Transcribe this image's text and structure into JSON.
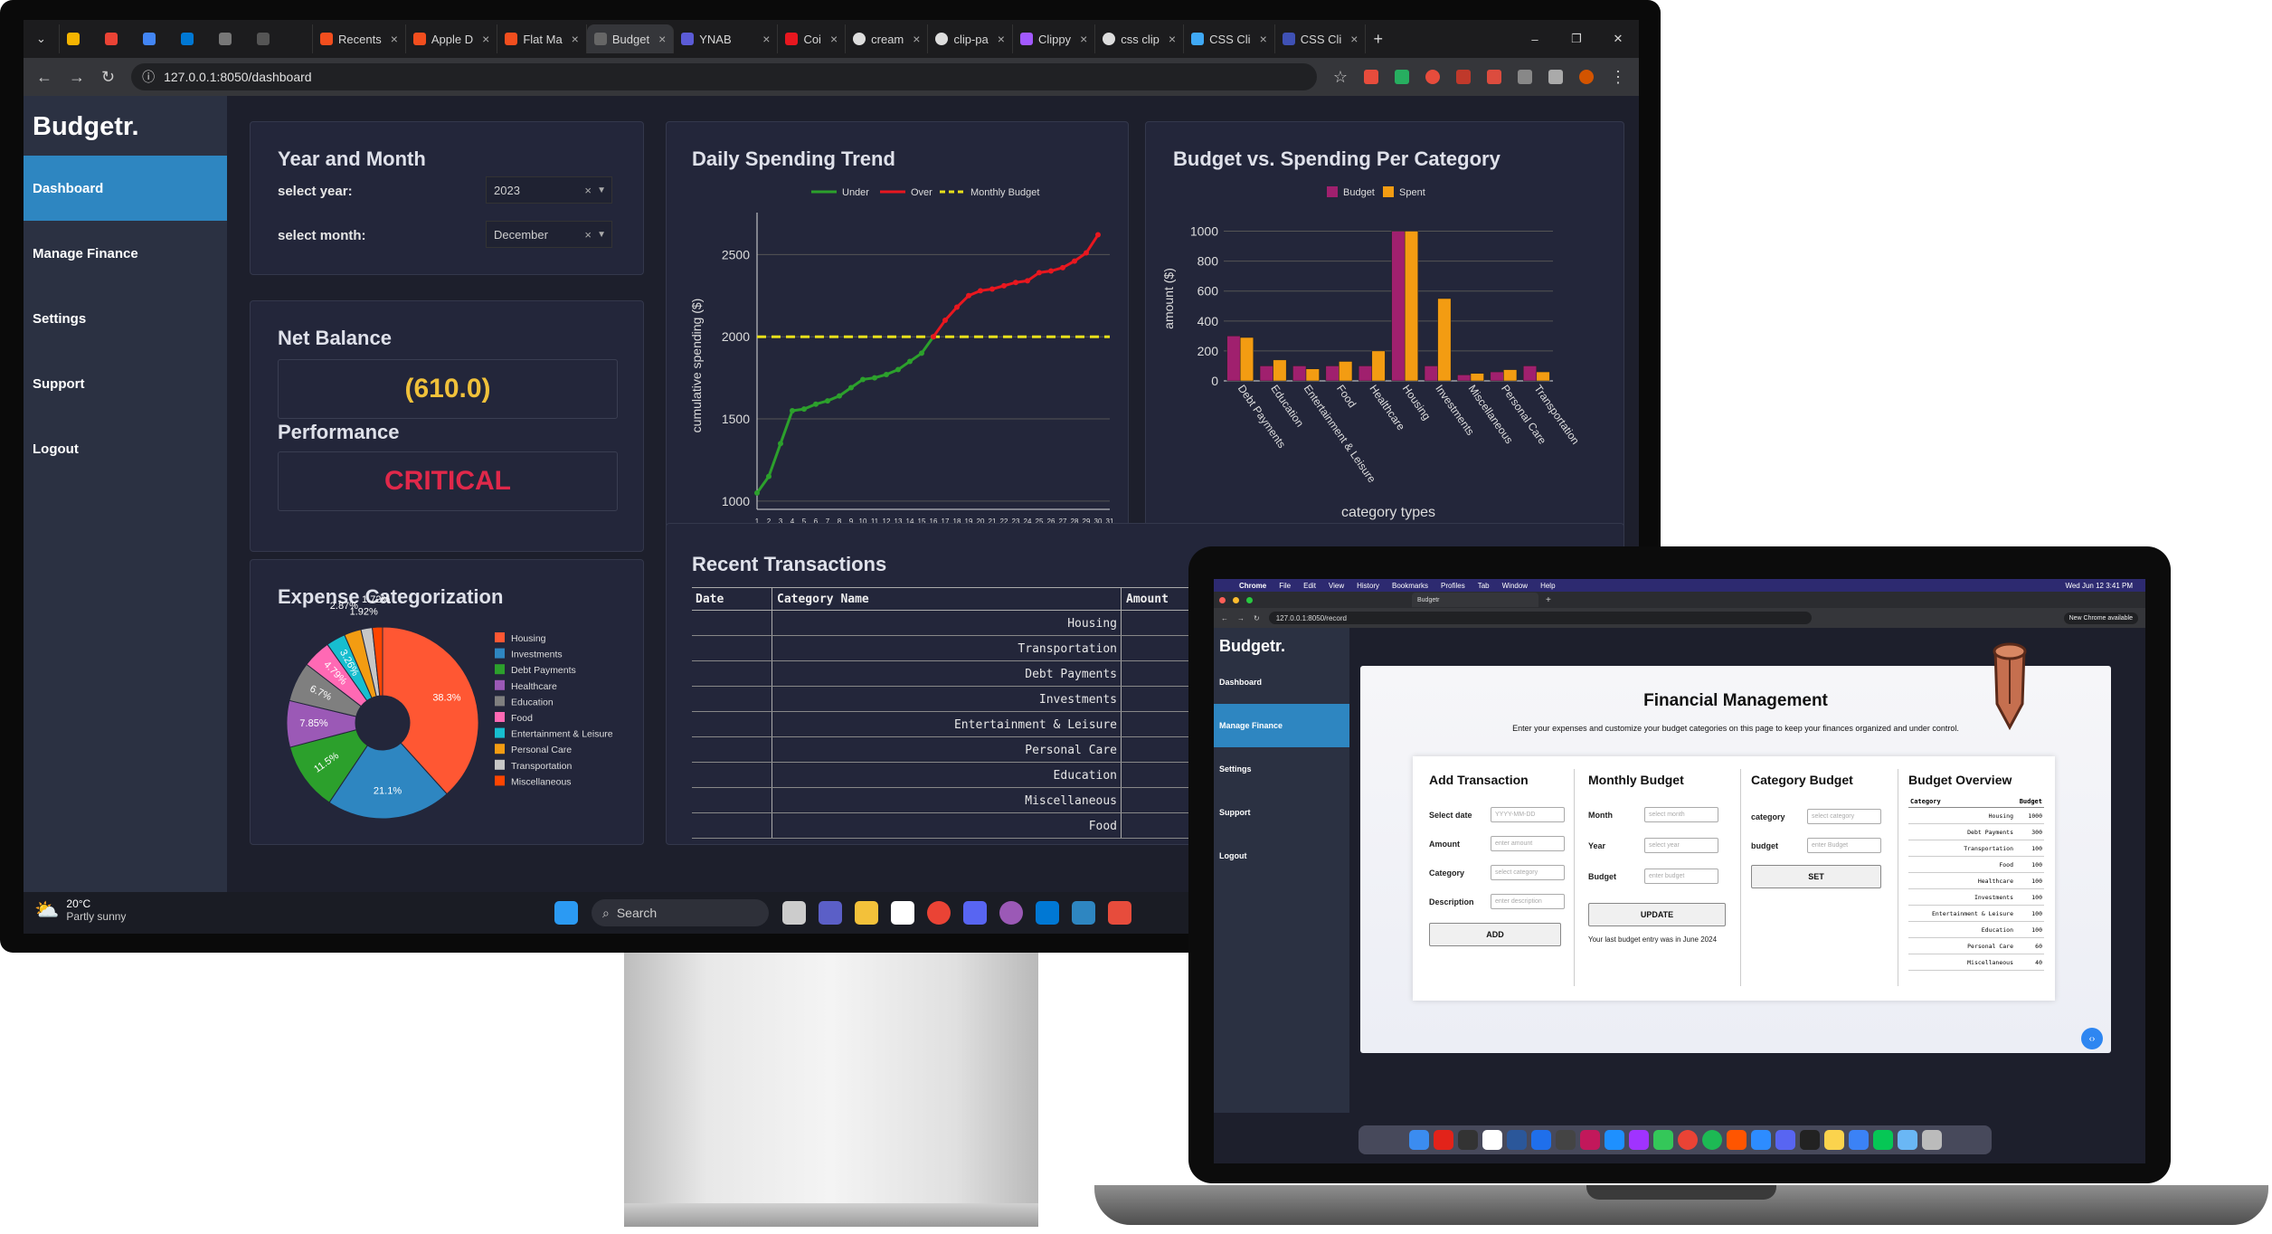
{
  "desktop": {
    "tabs": [
      {
        "label": "Recents"
      },
      {
        "label": "Apple D"
      },
      {
        "label": "Flat Ma"
      },
      {
        "label": "Budget"
      },
      {
        "label": "YNAB"
      },
      {
        "label": "Coi"
      },
      {
        "label": "cream"
      },
      {
        "label": "clip-pa"
      },
      {
        "label": "Clippy"
      },
      {
        "label": "css clip"
      },
      {
        "label": "CSS Cli"
      },
      {
        "label": "CSS Cli"
      }
    ],
    "url": "127.0.0.1:8050/dashboard",
    "brand": "Budgetr.",
    "nav": [
      {
        "label": "Dashboard"
      },
      {
        "label": "Manage Finance"
      },
      {
        "label": "Settings"
      },
      {
        "label": "Support"
      },
      {
        "label": "Logout"
      }
    ],
    "year_month": {
      "title": "Year and Month",
      "year_label": "select year:",
      "year_value": "2023",
      "month_label": "select month:",
      "month_value": "December"
    },
    "net_balance": {
      "title": "Net Balance",
      "value": "(610.0)",
      "value_color": "#f0c13a"
    },
    "performance": {
      "title": "Performance",
      "value": "CRITICAL",
      "value_color": "#e0284a"
    },
    "expense": {
      "title": "Expense Categorization"
    },
    "transactions": {
      "title": "Recent Transactions",
      "headers": [
        "Date",
        "Category Name",
        "Amount"
      ],
      "rows": [
        "Housing",
        "Transportation",
        "Debt Payments",
        "Investments",
        "Entertainment & Leisure",
        "Personal Care",
        "Education",
        "Miscellaneous",
        "Food"
      ]
    },
    "taskbar": {
      "weather_temp": "20°C",
      "weather_desc": "Partly sunny",
      "search": "Search"
    }
  },
  "chart_data": [
    {
      "type": "line",
      "title": "Daily Spending Trend",
      "xlabel": "day",
      "ylabel": "cumulative spending ($)",
      "legend": [
        "Under",
        "Over",
        "Monthly Budget"
      ],
      "legend_position": "top",
      "x": [
        1,
        2,
        3,
        4,
        5,
        6,
        7,
        8,
        9,
        10,
        11,
        12,
        13,
        14,
        15,
        16,
        17,
        18,
        19,
        20,
        21,
        22,
        23,
        24,
        25,
        26,
        27,
        28,
        29,
        30,
        31
      ],
      "series": [
        {
          "name": "Under",
          "color": "#2ca02c",
          "values": [
            1050,
            1150,
            1350,
            1550,
            1560,
            1590,
            1610,
            1640,
            1690,
            1740,
            1750,
            1770,
            1800,
            1850,
            1900,
            2000
          ]
        },
        {
          "name": "Over",
          "color": "#e8171f",
          "values": [
            2000,
            2100,
            2180,
            2250,
            2280,
            2290,
            2310,
            2330,
            2340,
            2390,
            2400,
            2420,
            2460,
            2510,
            2620
          ]
        },
        {
          "name": "Monthly Budget",
          "color": "#e8e01a",
          "values": [
            2000
          ]
        }
      ],
      "ylim": [
        950,
        2700
      ],
      "yticks": [
        1000,
        1500,
        2000,
        2500
      ]
    },
    {
      "type": "bar",
      "title": "Budget vs. Spending Per Category",
      "xlabel": "category types",
      "ylabel": "amount ($)",
      "legend": [
        "Budget",
        "Spent"
      ],
      "legend_position": "top",
      "categories": [
        "Debt Payments",
        "Education",
        "Entertainment & Leisure",
        "Food",
        "Healthcare",
        "Housing",
        "Investments",
        "Miscellaneous",
        "Personal Care",
        "Transportation"
      ],
      "series": [
        {
          "name": "Budget",
          "color": "#a0206e",
          "values": [
            300,
            100,
            100,
            100,
            100,
            1000,
            100,
            40,
            60,
            100
          ]
        },
        {
          "name": "Spent",
          "color": "#f39c12",
          "values": [
            290,
            140,
            80,
            130,
            200,
            1000,
            550,
            50,
            75,
            60
          ]
        }
      ],
      "ylim": [
        0,
        1100
      ],
      "yticks": [
        0,
        200,
        400,
        600,
        800,
        1000
      ]
    },
    {
      "type": "pie",
      "title": "Expense Categorization",
      "labels": [
        "Housing",
        "Investments",
        "Debt Payments",
        "Healthcare",
        "Education",
        "Food",
        "Entertainment & Leisure",
        "Personal Care",
        "Transportation",
        "Miscellaneous"
      ],
      "values": [
        38.3,
        21.1,
        11.5,
        7.85,
        6.7,
        4.79,
        3.26,
        2.87,
        1.92,
        1.72
      ],
      "value_labels": [
        "38.3%",
        "21.1%",
        "11.5%",
        "7.85%",
        "6.7%",
        "4.79%",
        "3.26%",
        "2.87%",
        "1.92%",
        "1.72%"
      ],
      "colors": [
        "#ff5733",
        "#2e86c1",
        "#2ca02c",
        "#9b59b6",
        "#7f7f7f",
        "#ff69b4",
        "#17becf",
        "#f39c12",
        "#c7c7c7",
        "#ff4500"
      ]
    }
  ],
  "laptop": {
    "menubar": [
      "Chrome",
      "File",
      "Edit",
      "View",
      "History",
      "Bookmarks",
      "Profiles",
      "Tab",
      "Window",
      "Help"
    ],
    "clock": "Wed Jun 12 3:41 PM",
    "tab": "Budgetr",
    "url": "127.0.0.1:8050/record",
    "update_btn": "New Chrome available",
    "brand": "Budgetr.",
    "nav": [
      {
        "label": "Dashboard"
      },
      {
        "label": "Manage Finance"
      },
      {
        "label": "Settings"
      },
      {
        "label": "Support"
      },
      {
        "label": "Logout"
      }
    ],
    "title": "Financial Management",
    "subtitle": "Enter your expenses and customize your budget categories on this page to keep your finances organized and under control.",
    "add": {
      "title": "Add Transaction",
      "date_label": "Select date",
      "date_ph": "YYYY-MM-DD",
      "amount_label": "Amount",
      "amount_ph": "enter amount",
      "category_label": "Category",
      "category_ph": "select category",
      "desc_label": "Description",
      "desc_ph": "enter description",
      "button": "ADD"
    },
    "monthly": {
      "title": "Monthly Budget",
      "month_label": "Month",
      "month_ph": "select month",
      "year_label": "Year",
      "year_ph": "select year",
      "budget_label": "Budget",
      "budget_ph": "enter budget",
      "button": "UPDATE",
      "note": "Your last budget entry was in June 2024"
    },
    "category": {
      "title": "Category Budget",
      "cat_label": "category",
      "cat_ph": "select category",
      "budget_label": "budget",
      "budget_ph": "enter Budget",
      "button": "SET"
    },
    "overview": {
      "title": "Budget Overview",
      "headers": [
        "Category",
        "Budget"
      ],
      "rows": [
        [
          "Housing",
          "1000"
        ],
        [
          "Debt Payments",
          "300"
        ],
        [
          "Transportation",
          "100"
        ],
        [
          "Food",
          "100"
        ],
        [
          "Healthcare",
          "100"
        ],
        [
          "Investments",
          "100"
        ],
        [
          "Entertainment & Leisure",
          "100"
        ],
        [
          "Education",
          "100"
        ],
        [
          "Personal Care",
          "60"
        ],
        [
          "Miscellaneous",
          "40"
        ]
      ]
    }
  }
}
